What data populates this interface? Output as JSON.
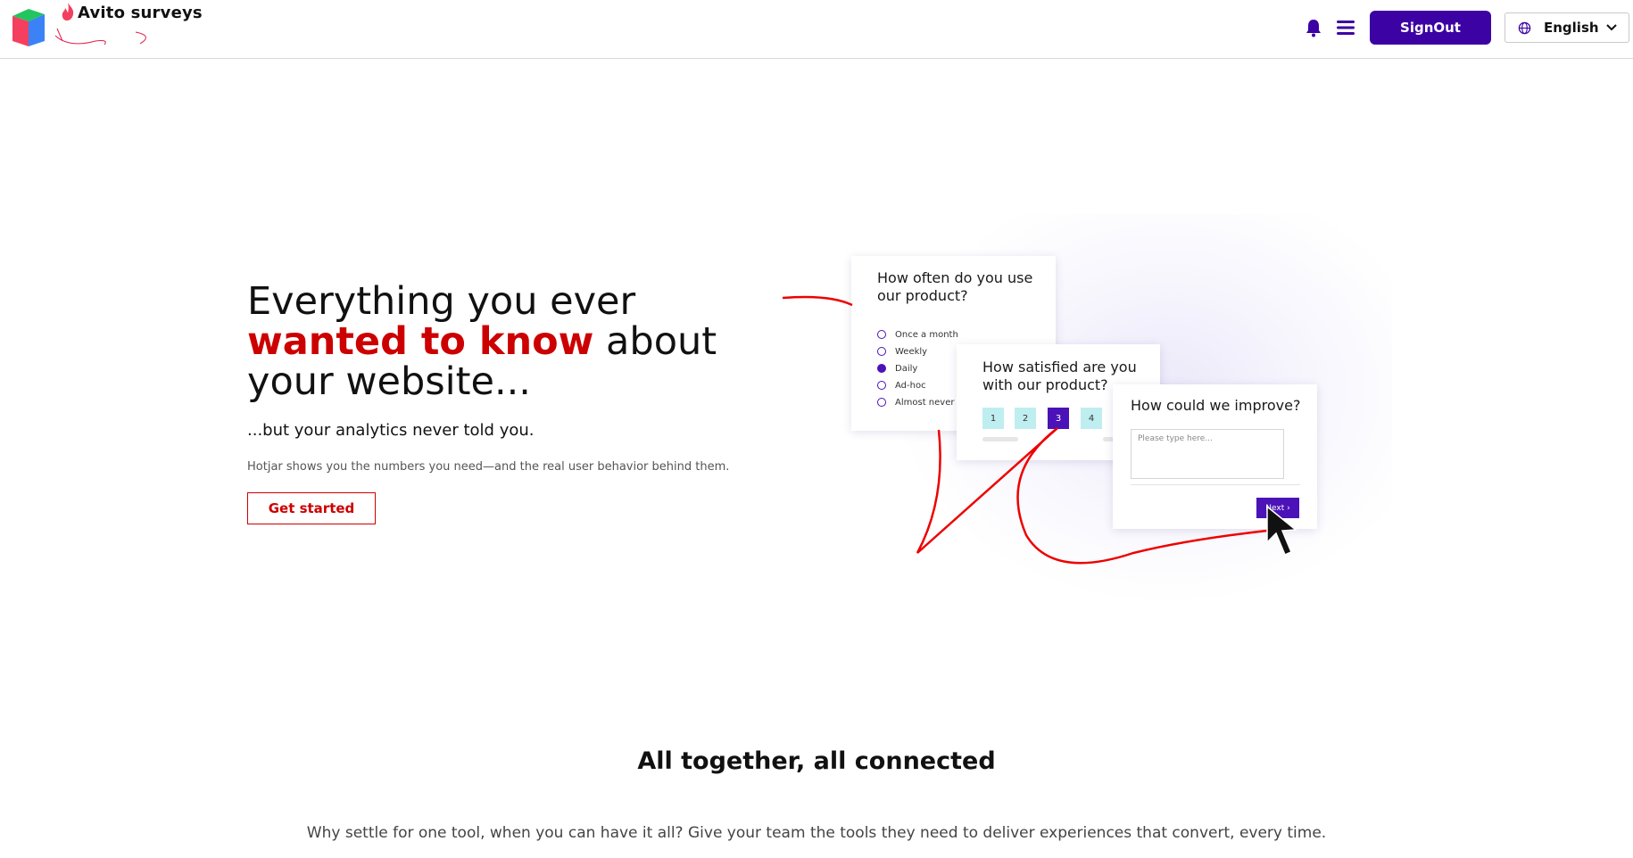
{
  "header": {
    "brand": "Avito surveys",
    "signout_label": "SignOut",
    "language": "English",
    "accent_color": "#3d02a3"
  },
  "hero": {
    "title_part1": "Everything you ever ",
    "title_highlight": "wanted to know",
    "title_part2": " about your website...",
    "subtitle": "...but your analytics never told you.",
    "description": "Hotjar shows you the numbers you need—and the real user behavior behind them.",
    "cta_label": "Get started",
    "highlight_color": "#cc0000"
  },
  "survey_cards": {
    "card1": {
      "question": "How often do you use our product?",
      "options": [
        "Once a month",
        "Weekly",
        "Daily",
        "Ad-hoc",
        "Almost never"
      ],
      "selected": "Daily"
    },
    "card2": {
      "question": "How satisfied are you with our product?",
      "scale": [
        "1",
        "2",
        "3",
        "4"
      ],
      "selected": "3"
    },
    "card3": {
      "question": "How could we improve?",
      "placeholder": "Please type here...",
      "next_label": "Next"
    }
  },
  "section": {
    "title": "All together, all connected",
    "description": "Why settle for one tool, when you can have it all? Give your team the tools they need to deliver experiences that convert, every time."
  },
  "icons": [
    "logo-cube-icon",
    "flame-icon",
    "bell-icon",
    "hamburger-menu-icon",
    "globe-icon",
    "chevron-down-icon",
    "cursor-pointer-icon"
  ]
}
